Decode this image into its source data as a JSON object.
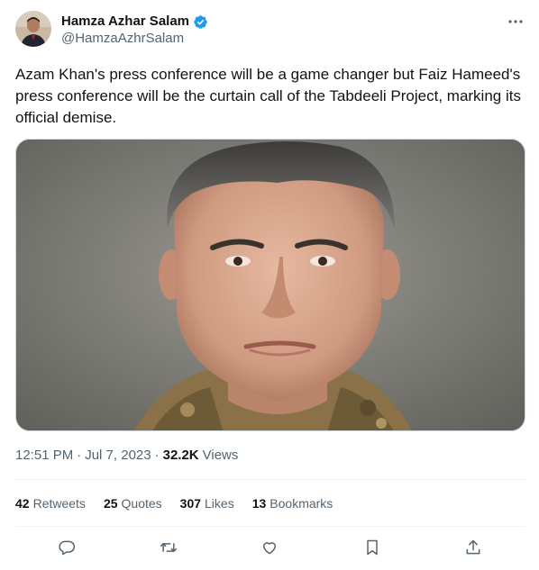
{
  "author": {
    "display_name": "Hamza Azhar Salam",
    "handle": "@HamzaAzhrSalam",
    "avatar_icon": "avatar",
    "verified_icon": "verified-badge-icon",
    "verified_color": "#1d9bf0"
  },
  "tweet": {
    "text": "Azam Khan's press conference will be a game changer but Faiz Hameed's press conference will be the curtain call of the Tabdeeli Project, marking its official demise.",
    "media_icon": "portrait-photo"
  },
  "meta": {
    "time": "12:51 PM",
    "separator": "·",
    "date": "Jul 7, 2023",
    "views_separator": "·",
    "views_count": "32.2K",
    "views_label": "Views"
  },
  "stats": {
    "retweets_count": "42",
    "retweets_label": "Retweets",
    "quotes_count": "25",
    "quotes_label": "Quotes",
    "likes_count": "307",
    "likes_label": "Likes",
    "bookmarks_count": "13",
    "bookmarks_label": "Bookmarks"
  },
  "actions": [
    "reply-icon",
    "retweet-icon",
    "like-icon",
    "bookmark-icon",
    "share-icon"
  ],
  "colors": {
    "text": "#0f1419",
    "secondary": "#536471",
    "divider": "#eff3f4",
    "accent": "#1d9bf0"
  }
}
